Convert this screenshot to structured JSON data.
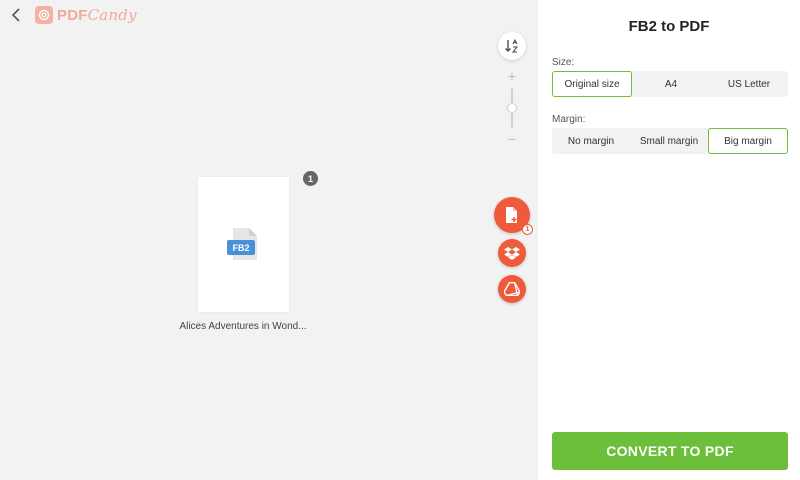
{
  "logo": {
    "pdf": "PDF",
    "candy": "Candy"
  },
  "workspace": {
    "file": {
      "name": "Alices Adventures in Wond...",
      "type_label": "FB2",
      "index_badge": "1"
    },
    "upload_count_badge": "1",
    "sort_icon": "sort-az-icon"
  },
  "panel": {
    "title": "FB2 to PDF",
    "size": {
      "label": "Size:",
      "options": [
        "Original size",
        "A4",
        "US Letter"
      ],
      "selected": "Original size"
    },
    "margin": {
      "label": "Margin:",
      "options": [
        "No margin",
        "Small margin",
        "Big margin"
      ],
      "selected": "Big margin"
    },
    "convert_label": "CONVERT TO PDF"
  },
  "colors": {
    "accent_green": "#6cbf3b",
    "brand_orange": "#ef5a3c",
    "logo_pink": "#f0a99b"
  }
}
